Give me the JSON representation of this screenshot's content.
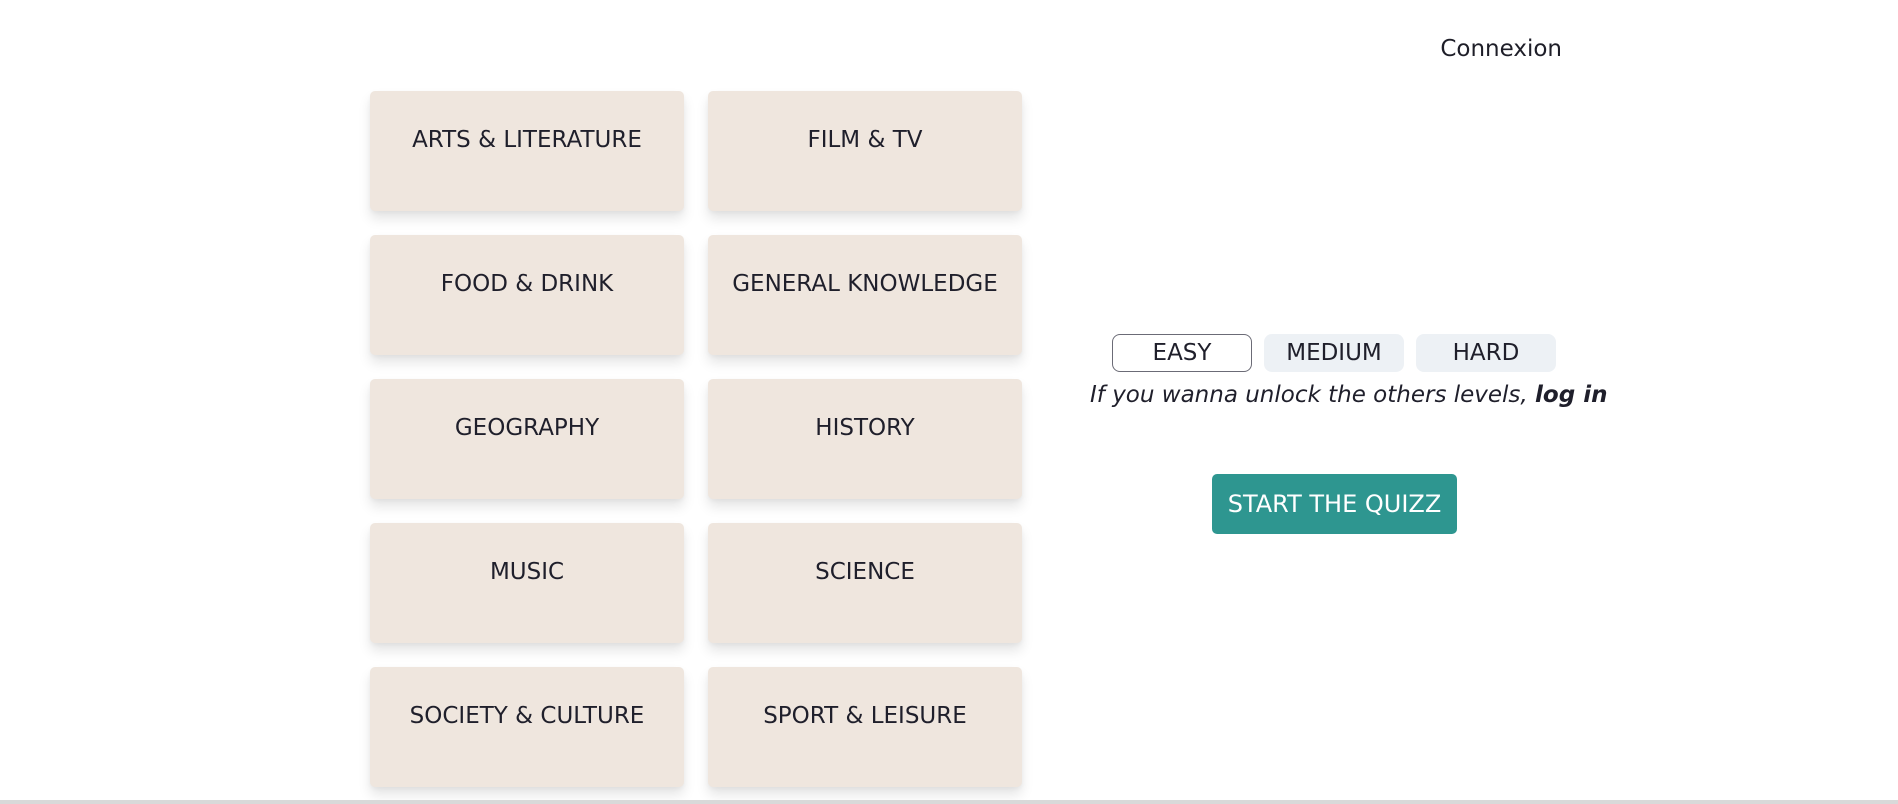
{
  "header": {
    "login_label": "Connexion"
  },
  "categories": [
    {
      "label": "ARTS & LITERATURE"
    },
    {
      "label": "FILM & TV"
    },
    {
      "label": "FOOD & DRINK"
    },
    {
      "label": "GENERAL KNOWLEDGE"
    },
    {
      "label": "GEOGRAPHY"
    },
    {
      "label": "HISTORY"
    },
    {
      "label": "MUSIC"
    },
    {
      "label": "SCIENCE"
    },
    {
      "label": "SOCIETY & CULTURE"
    },
    {
      "label": "SPORT & LEISURE"
    }
  ],
  "levels": {
    "items": [
      {
        "label": "EASY"
      },
      {
        "label": "MEDIUM"
      },
      {
        "label": "HARD"
      }
    ],
    "selected": "EASY",
    "note_text": "If you wanna unlock the others levels, ",
    "note_link": "log in"
  },
  "start": {
    "label": "START THE QUIZZ"
  },
  "colors": {
    "card_background": "#efe6de",
    "level_background": "#edf1f5",
    "start_button": "#2e9690",
    "text": "#1f1f2b"
  }
}
